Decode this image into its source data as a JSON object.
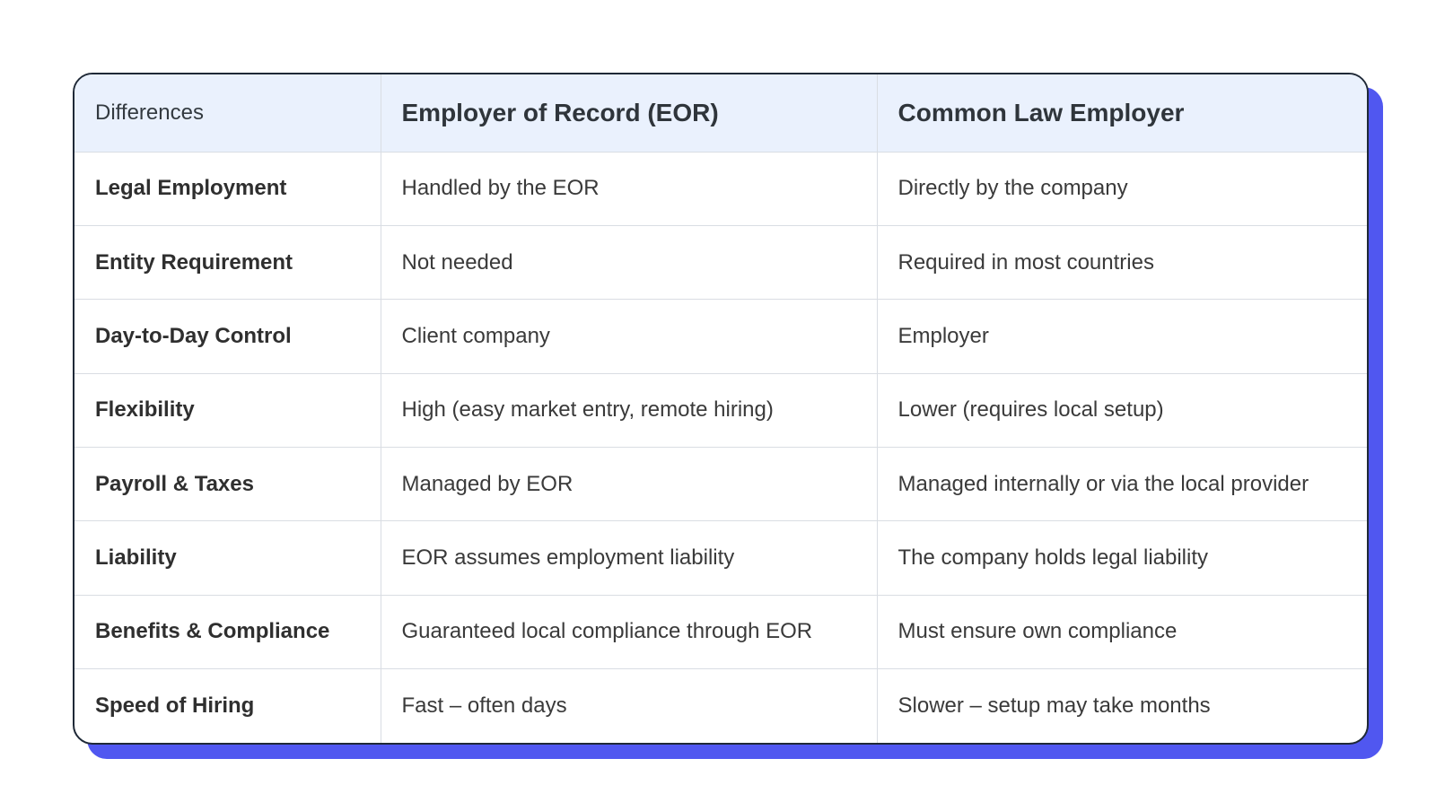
{
  "table": {
    "headers": [
      "Differences",
      "Employer of Record (EOR)",
      "Common Law Employer"
    ],
    "rows": [
      [
        "Legal Employment",
        "Handled by the EOR",
        "Directly by the company"
      ],
      [
        "Entity Requirement",
        "Not needed",
        "Required in most countries"
      ],
      [
        "Day-to-Day Control",
        "Client company",
        "Employer"
      ],
      [
        "Flexibility",
        "High (easy market entry, remote hiring)",
        "Lower (requires local setup)"
      ],
      [
        "Payroll & Taxes",
        "Managed by EOR",
        "Managed internally or via the local provider"
      ],
      [
        "Liability",
        "EOR assumes employment liability",
        "The company holds legal liability"
      ],
      [
        "Benefits & Compliance",
        "Guaranteed local compliance through EOR",
        "Must ensure own compliance"
      ],
      [
        "Speed of Hiring",
        "Fast – often days",
        "Slower – setup may take months"
      ]
    ]
  },
  "colors": {
    "shadow": "#5057f0",
    "header_background": "#eaf1fd",
    "border": "#1f2937"
  }
}
